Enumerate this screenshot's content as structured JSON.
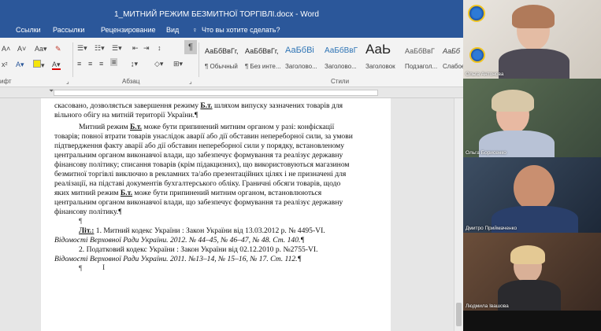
{
  "word": {
    "title": "1_МИТНИЙ РЕЖИМ БЕЗМИТНОЇ ТОРГІВЛІ.docx - Word",
    "tabs": [
      "Ссылки",
      "Рассылки",
      "Рецензирование",
      "Вид"
    ],
    "tell_me": "Что вы хотите сделать?",
    "groups": {
      "paragraph": "Абзац",
      "styles": "Стили",
      "font_stub": "ифт"
    },
    "font_buttons": [
      "A˄",
      "A˅",
      "Aa▾",
      "x²"
    ],
    "styles": [
      {
        "sample": "АаБбВвГг,",
        "name": "¶ Обычный"
      },
      {
        "sample": "АаБбВвГг,",
        "name": "¶ Без инте..."
      },
      {
        "sample": "АаБбВі",
        "name": "Заголово..."
      },
      {
        "sample": "АаБбВвГ",
        "name": "Заголово..."
      },
      {
        "sample": "АаЬ",
        "name": "Заголовок"
      },
      {
        "sample": "АаБбВвГ",
        "name": "Подзагол..."
      },
      {
        "sample": "АаБб",
        "name": "Слабое"
      }
    ],
    "document_lines": [
      "скасовано, дозволяється завершення режиму Б.т. шляхом випуску зазначених товарів для",
      "вільного обігу на митній території України.¶",
      "Митний режим Б.т. може бути припинений митним органом у разі: конфіскації",
      "товарів; повної втрати товарів унаслідок аварії або дії обставин непереборної сили, за умови",
      "підтвердження факту аварії або дії обставин непереборної сили у порядку, встановленому",
      "центральним органом виконавчої влади, що забезпечує формування та реалізує державну",
      "фінансову політику; списання товарів (крім підакцизних), що використовуються магазином",
      "безмитної торгівлі виключно в рекламних та/або презентаційних цілях і не призначені для",
      "реалізації, на підставі документів бухгалтерського обліку. Граничні обсяги товарів, щодо",
      "яких митний режим Б.т. може бути припинений митним органом, встановлюються",
      "центральним органом виконавчої влади, що забезпечує формування та реалізує державну",
      "фінансову політику.¶",
      "¶",
      "Літ.: 1. Митний кодекс України : Закон України від 13.03.2012 р. № 4495-VI.",
      "Відомості Верховної Ради України. 2012. № 44–45, № 46–47, № 48. Ст. 140.¶",
      "2. Податковий кодекс України : Закон України від 02.12.2010 р. №2755-VI.",
      "Відомості Верховної Ради України. 2011. №13–14, № 15–16, № 17. Ст. 112.¶",
      "¶"
    ]
  },
  "participants": [
    {
      "name": "Ольга Антонова"
    },
    {
      "name": "Ольга Борисенко"
    },
    {
      "name": "Дмитро Приймаченко"
    },
    {
      "name": "Людмила Івашова"
    }
  ],
  "colors": {
    "word_blue": "#2b579a"
  }
}
